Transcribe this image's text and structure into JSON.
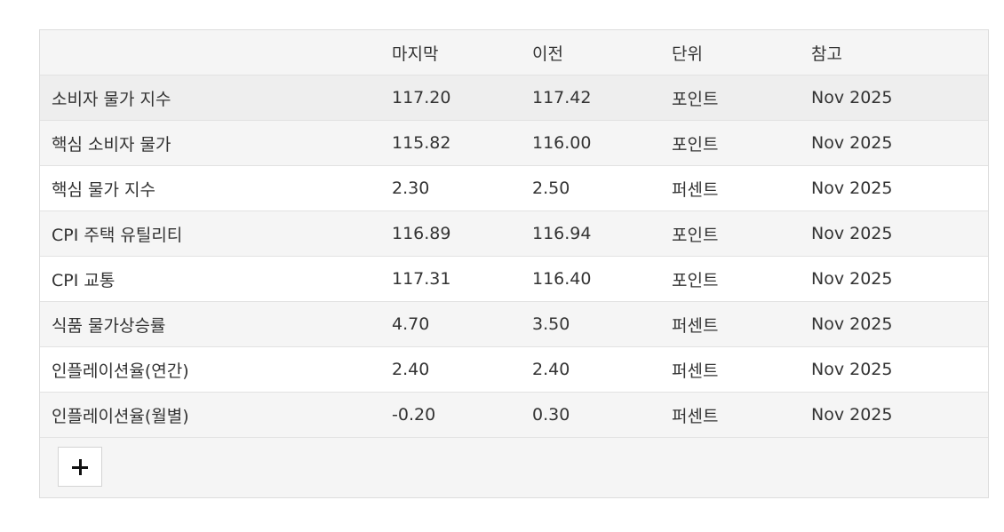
{
  "table": {
    "columns": [
      "",
      "마지막",
      "이전",
      "단위",
      "참고"
    ],
    "rows": [
      {
        "name": "소비자 물가 지수",
        "last": "117.20",
        "previous": "117.42",
        "unit": "포인트",
        "reference": "Nov 2025"
      },
      {
        "name": "핵심 소비자 물가",
        "last": "115.82",
        "previous": "116.00",
        "unit": "포인트",
        "reference": "Nov 2025"
      },
      {
        "name": "핵심 물가 지수",
        "last": "2.30",
        "previous": "2.50",
        "unit": "퍼센트",
        "reference": "Nov 2025"
      },
      {
        "name": "CPI 주택 유틸리티",
        "last": "116.89",
        "previous": "116.94",
        "unit": "포인트",
        "reference": "Nov 2025"
      },
      {
        "name": "CPI 교통",
        "last": "117.31",
        "previous": "116.40",
        "unit": "포인트",
        "reference": "Nov 2025"
      },
      {
        "name": "식품 물가상승률",
        "last": "4.70",
        "previous": "3.50",
        "unit": "퍼센트",
        "reference": "Nov 2025"
      },
      {
        "name": "인플레이션율(연간)",
        "last": "2.40",
        "previous": "2.40",
        "unit": "퍼센트",
        "reference": "Nov 2025"
      },
      {
        "name": "인플레이션율(월별)",
        "last": "-0.20",
        "previous": "0.30",
        "unit": "퍼센트",
        "reference": "Nov 2025"
      }
    ]
  },
  "footer": {
    "add_button_icon": "plus-icon"
  }
}
